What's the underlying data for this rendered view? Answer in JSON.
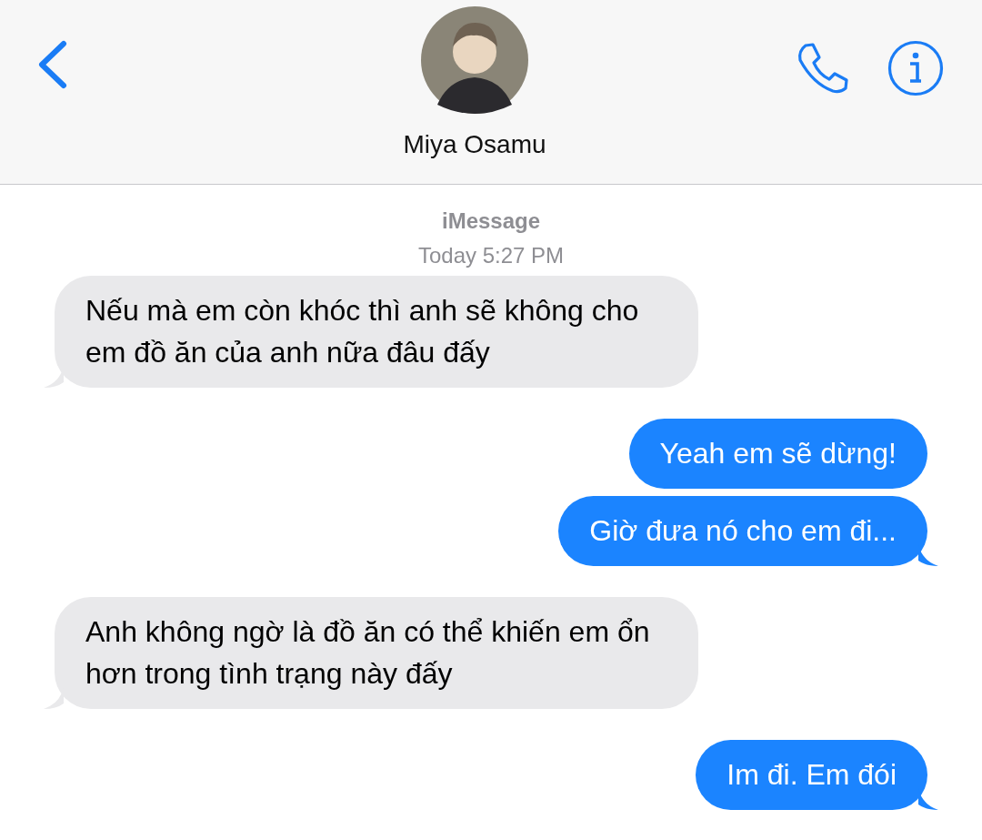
{
  "header": {
    "contact_name": "Miya Osamu"
  },
  "service": "iMessage",
  "timestamp": "Today 5:27 PM",
  "messages": [
    {
      "kind": "received",
      "text": "Nếu mà em còn khóc thì anh sẽ không cho em đồ ăn của anh nữa đâu đấy",
      "tail": true
    },
    {
      "kind": "sent",
      "text": "Yeah em sẽ dừng!",
      "tail": false
    },
    {
      "kind": "sent",
      "text": "Giờ đưa nó cho em đi...",
      "tail": true
    },
    {
      "kind": "received",
      "text": "Anh không ngờ là đồ ăn có thể khiến em ổn hơn trong tình trạng này đấy",
      "tail": true
    },
    {
      "kind": "sent",
      "text": "Im đi. Em đói",
      "tail": true
    }
  ]
}
